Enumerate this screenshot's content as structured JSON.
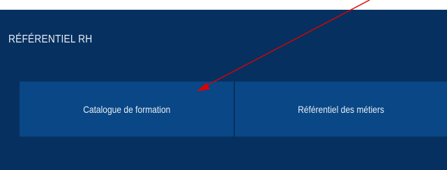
{
  "section": {
    "title": "RÉFÉRENTIEL RH"
  },
  "menu": {
    "items": [
      {
        "label": "Catalogue de formation"
      },
      {
        "label": "Référentiel des métiers"
      }
    ]
  },
  "colors": {
    "panel_background": "#063060",
    "tile_background": "#094786",
    "text": "#e9eef5",
    "annotation_arrow": "#e00000"
  }
}
